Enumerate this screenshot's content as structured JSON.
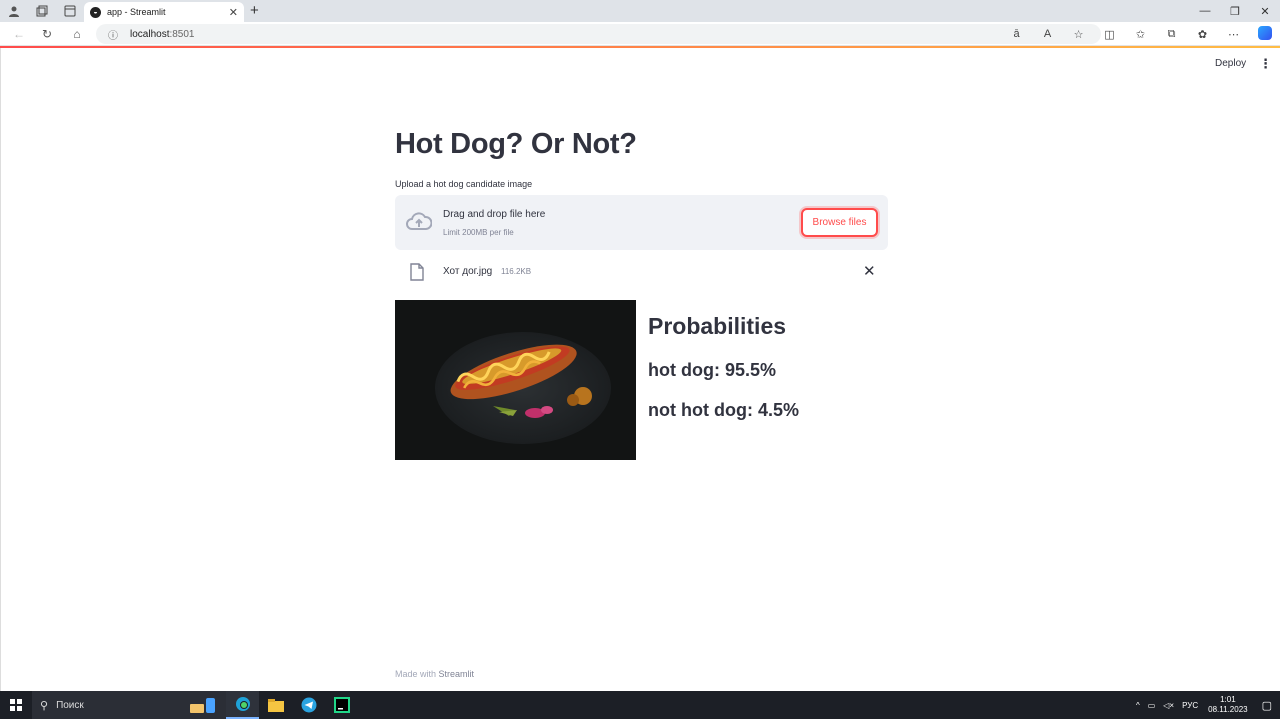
{
  "browser": {
    "tab_title": "app - Streamlit",
    "url_host": "localhost",
    "url_port": ":8501"
  },
  "header": {
    "deploy_label": "Deploy"
  },
  "main": {
    "title": "Hot Dog? Or Not?",
    "uploader_label": "Upload a hot dog candidate image",
    "dropzone_text": "Drag and drop file here",
    "dropzone_limit": "Limit 200MB per file",
    "browse_label": "Browse files",
    "file_name": "Хот дог.jpg",
    "file_size": "116.2KB",
    "probabilities_title": "Probabilities",
    "prob_hotdog": "hot dog: 95.5%",
    "prob_not": "not hot dog: 4.5%"
  },
  "footer": {
    "made_with": "Made with",
    "brand": "Streamlit"
  },
  "taskbar": {
    "search_placeholder": "Поиск",
    "lang": "РУС",
    "time": "1:01",
    "date": "08.11.2023"
  },
  "colors": {
    "accent": "#ff4b4b",
    "text": "#31333f",
    "dropzone_bg": "#f0f2f6"
  }
}
